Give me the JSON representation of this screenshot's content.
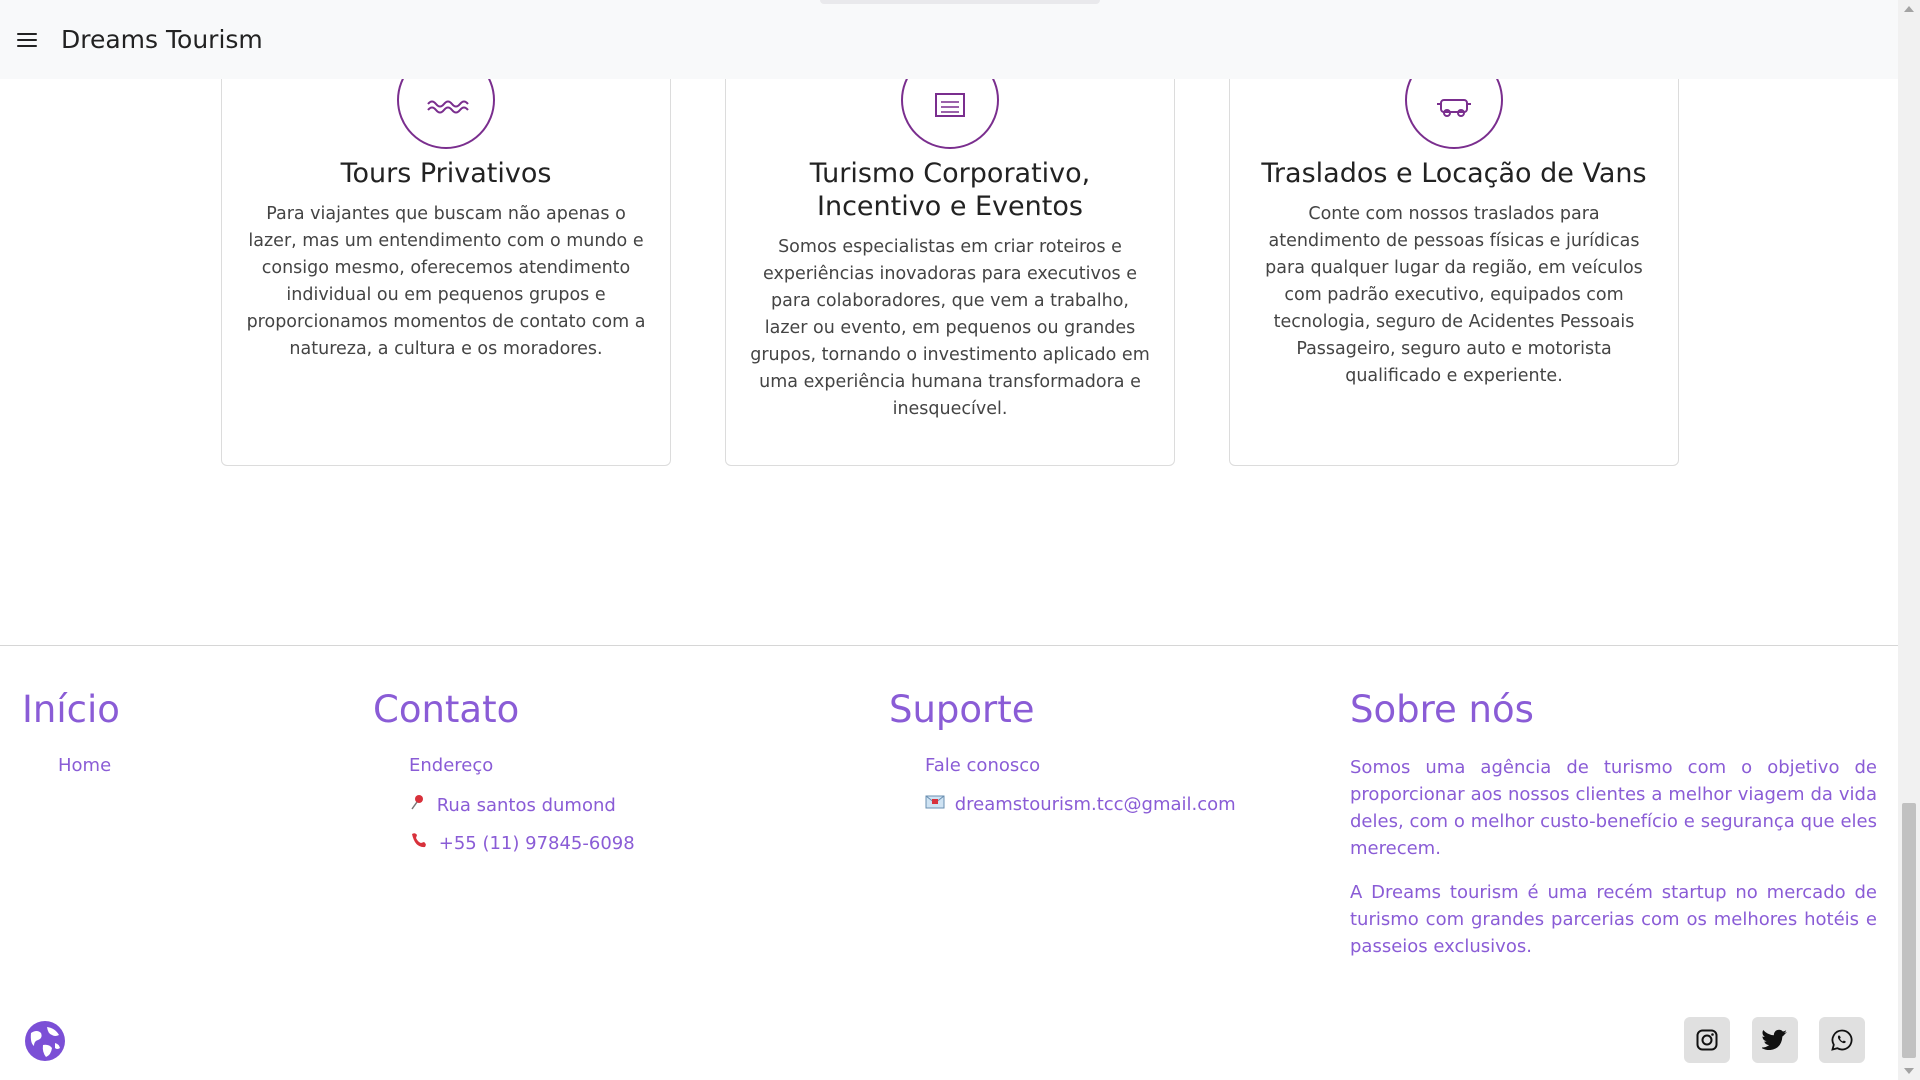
{
  "navbar": {
    "brand": "Dreams Tourism"
  },
  "services": [
    {
      "title": "Tours Privativos",
      "description": "Para viajantes que buscam não apenas o lazer, mas um entendimento com o mundo e consigo mesmo, oferecemos atendimento individual ou em pequenos grupos e proporcionamos momentos de contato com a natureza, a cultura e os moradores.",
      "icon": "waves-icon"
    },
    {
      "title": "Turismo Corporativo, Incentivo e Eventos",
      "description": "Somos especialistas em criar roteiros e experiências inovadoras para executivos e para colaboradores, que vem a trabalho, lazer ou evento, em pequenos ou grandes grupos, tornando o investimento aplicado em uma experiência humana transformadora e inesquecível.",
      "icon": "document-icon"
    },
    {
      "title": "Traslados e Locação de Vans",
      "description": "Conte com nossos traslados para atendimento de pessoas físicas e jurídicas para qualquer lugar da região, em veículos com padrão executivo, equipados com tecnologia, seguro de Acidentes Pessoais Passageiro, seguro auto e motorista qualificado e experiente.",
      "icon": "van-icon"
    }
  ],
  "footer": {
    "inicio": {
      "title": "Início",
      "home": "Home"
    },
    "contato": {
      "title": "Contato",
      "endereco": "Endereço",
      "address": "Rua santos dumond",
      "phone": "+55 (11) 97845-6098"
    },
    "suporte": {
      "title": "Suporte",
      "fale": "Fale conosco",
      "email": "dreamstourism.tcc@gmail.com"
    },
    "sobre": {
      "title": "Sobre nós",
      "p1": "Somos uma agência de turismo com o objetivo de proporcionar aos nossos clientes a melhor viagem da vida deles, com o melhor custo-benefício e segurança que eles merecem.",
      "p2": "A Dreams tourism é uma recém startup no mercado de turismo com grandes parcerias com os melhores hotéis e passeios exclusivos."
    }
  },
  "colors": {
    "accent": "#8a5cd6",
    "icon_stroke": "#7a2e8e"
  }
}
